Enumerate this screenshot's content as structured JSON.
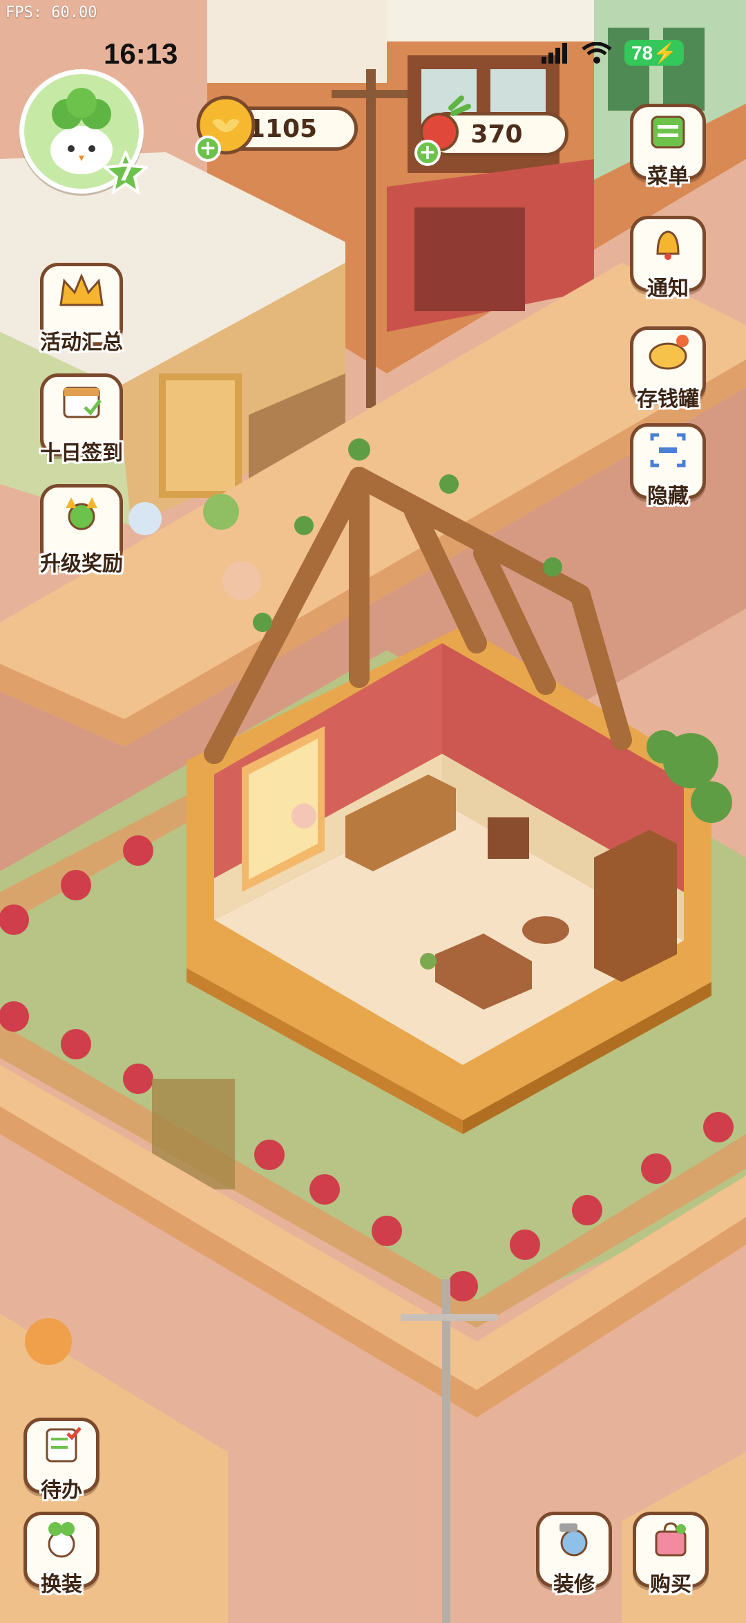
{
  "status_bar": {
    "fps": "FPS: 60.00",
    "time": "16:13",
    "battery": "78"
  },
  "player": {
    "level": "7"
  },
  "currencies": {
    "coins": "1105",
    "food": "370"
  },
  "left_menu": [
    {
      "label": "活动汇总",
      "icon": "crown-icon"
    },
    {
      "label": "十日签到",
      "icon": "calendar-icon"
    },
    {
      "label": "升级奖励",
      "icon": "level-up-icon"
    }
  ],
  "right_menu": [
    {
      "label": "菜单",
      "icon": "menu-icon"
    },
    {
      "label": "通知",
      "icon": "bell-icon"
    },
    {
      "label": "存钱罐",
      "icon": "piggy-bank-icon"
    },
    {
      "label": "隐藏",
      "icon": "hide-icon"
    }
  ],
  "bottom_left": [
    {
      "label": "待办",
      "icon": "todo-list-icon"
    },
    {
      "label": "换装",
      "icon": "outfit-icon"
    }
  ],
  "bottom_right": [
    {
      "label": "装修",
      "icon": "decorate-icon"
    },
    {
      "label": "购买",
      "icon": "shop-bag-icon"
    }
  ],
  "colors": {
    "accent_green": "#6cc24a",
    "outline_brown": "#7b4a2c",
    "coin_gold": "#f5b82e"
  }
}
